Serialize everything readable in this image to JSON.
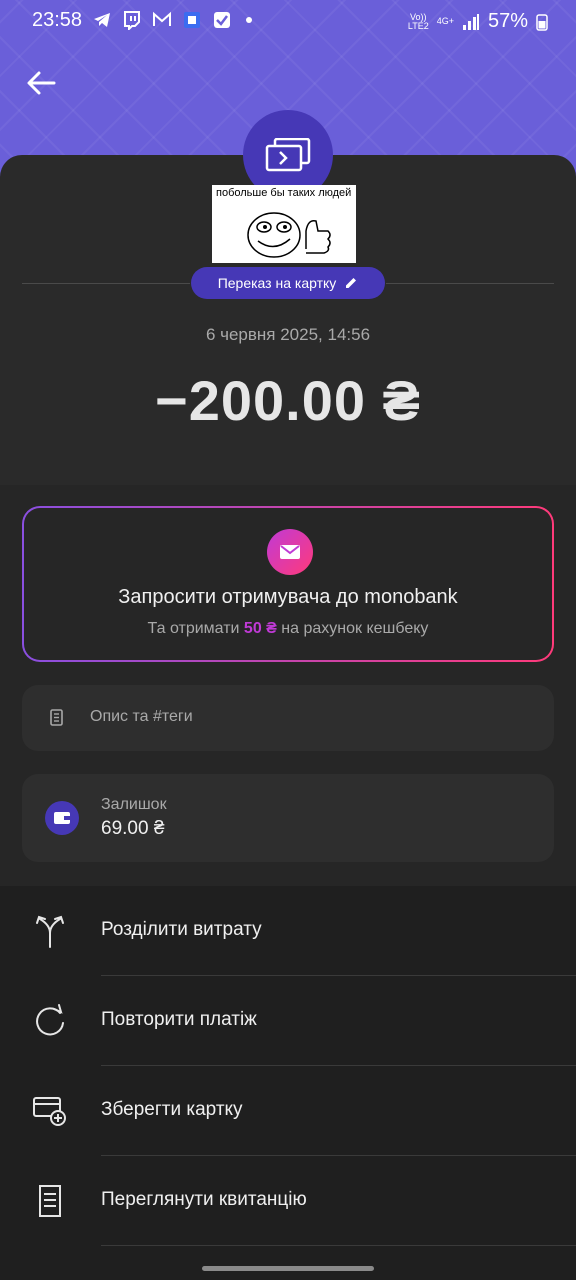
{
  "status": {
    "time": "23:58",
    "network_top": "Vo))",
    "network_bottom": "LTE2",
    "network_type": "4G+",
    "battery": "57%"
  },
  "transaction": {
    "meme_text": "побольше бы таких людей",
    "type_label": "Переказ на картку",
    "date": "6 червня 2025, 14:56",
    "amount": "−200.00 ₴"
  },
  "invite": {
    "title": "Запросити отримувача до monobank",
    "sub_prefix": "Та отримати",
    "sub_amount": "50 ₴",
    "sub_suffix": "на рахунок кешбеку"
  },
  "description": {
    "label": "Опис та #теги"
  },
  "balance": {
    "label": "Залишок",
    "value": "69.00 ₴"
  },
  "actions": [
    {
      "label": "Розділити витрату",
      "icon": "split-icon"
    },
    {
      "label": "Повторити платіж",
      "icon": "repeat-icon"
    },
    {
      "label": "Зберегти картку",
      "icon": "save-card-icon"
    },
    {
      "label": "Переглянути квитанцію",
      "icon": "receipt-icon"
    }
  ],
  "colors": {
    "header": "#6a5fd9",
    "accent": "#4638b6",
    "pink": "#c03ad6"
  }
}
